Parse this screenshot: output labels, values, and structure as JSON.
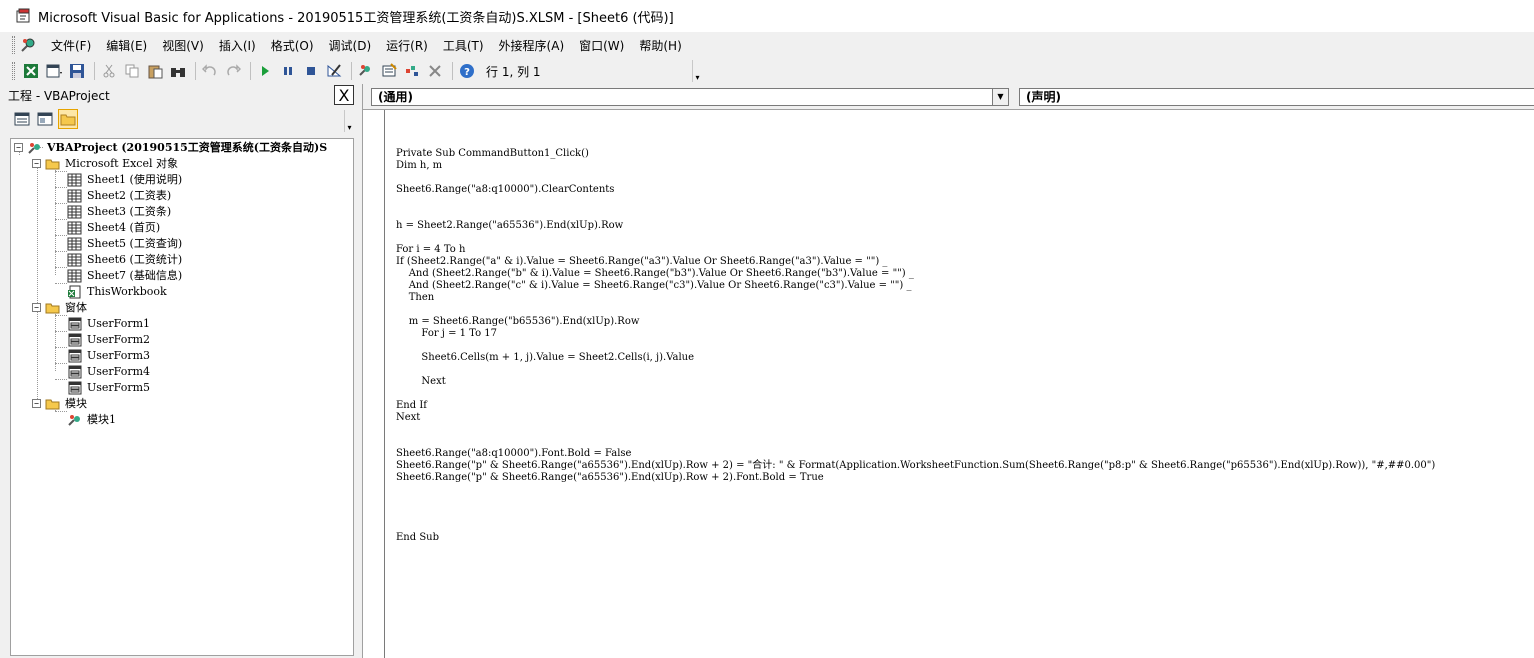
{
  "window": {
    "title": "Microsoft Visual Basic for Applications - 20190515工资管理系统(工资条自动)S.XLSM - [Sheet6 (代码)]"
  },
  "menu": [
    "文件(F)",
    "编辑(E)",
    "视图(V)",
    "插入(I)",
    "格式(O)",
    "调试(D)",
    "运行(R)",
    "工具(T)",
    "外接程序(A)",
    "窗口(W)",
    "帮助(H)"
  ],
  "toolbar": {
    "position": "行 1, 列 1",
    "icons": [
      "excel-icon",
      "insert-userform-icon",
      "save-icon",
      "cut-icon",
      "copy-icon",
      "paste-icon",
      "find-icon",
      "undo-icon",
      "redo-icon",
      "run-icon",
      "break-icon",
      "reset-icon",
      "design-mode-icon",
      "project-explorer-icon",
      "properties-icon",
      "object-browser-icon",
      "toolbox-icon",
      "help-icon"
    ]
  },
  "project": {
    "header": "工程 - VBAProject",
    "close": "X",
    "tree": {
      "root": "VBAProject (20190515工资管理系统(工资条自动)S",
      "groups": [
        {
          "name": "Microsoft Excel 对象",
          "items": [
            "Sheet1 (使用说明)",
            "Sheet2 (工资表)",
            "Sheet3 (工资条)",
            "Sheet4 (首页)",
            "Sheet5 (工资查询)",
            "Sheet6 (工资统计)",
            "Sheet7 (基础信息)",
            "ThisWorkbook"
          ]
        },
        {
          "name": "窗体",
          "items": [
            "UserForm1",
            "UserForm2",
            "UserForm3",
            "UserForm4",
            "UserForm5"
          ]
        },
        {
          "name": "模块",
          "items": [
            "模块1"
          ]
        }
      ]
    }
  },
  "editor": {
    "object_combo": "(通用)",
    "proc_combo": "(声明)",
    "code_lines": [
      "",
      "",
      "",
      "Private Sub CommandButton1_Click()",
      "Dim h, m",
      "",
      "Sheet6.Range(\"a8:q10000\").ClearContents",
      "",
      "",
      "h = Sheet2.Range(\"a65536\").End(xlUp).Row",
      "",
      "For i = 4 To h",
      "If (Sheet2.Range(\"a\" & i).Value = Sheet6.Range(\"a3\").Value Or Sheet6.Range(\"a3\").Value = \"\") _",
      "    And (Sheet2.Range(\"b\" & i).Value = Sheet6.Range(\"b3\").Value Or Sheet6.Range(\"b3\").Value = \"\") _",
      "    And (Sheet2.Range(\"c\" & i).Value = Sheet6.Range(\"c3\").Value Or Sheet6.Range(\"c3\").Value = \"\") _",
      "    Then",
      "",
      "    m = Sheet6.Range(\"b65536\").End(xlUp).Row",
      "        For j = 1 To 17",
      "",
      "        Sheet6.Cells(m + 1, j).Value = Sheet2.Cells(i, j).Value",
      "",
      "        Next",
      "",
      "End If",
      "Next",
      "",
      "",
      "Sheet6.Range(\"a8:q10000\").Font.Bold = False",
      "Sheet6.Range(\"p\" & Sheet6.Range(\"a65536\").End(xlUp).Row + 2) = \"合计: \" & Format(Application.WorksheetFunction.Sum(Sheet6.Range(\"p8:p\" & Sheet6.Range(\"p65536\").End(xlUp).Row)), \"#,##0.00\")",
      "Sheet6.Range(\"p\" & Sheet6.Range(\"a65536\").End(xlUp).Row + 2).Font.Bold = True",
      "",
      "",
      "",
      "",
      "End Sub"
    ]
  }
}
